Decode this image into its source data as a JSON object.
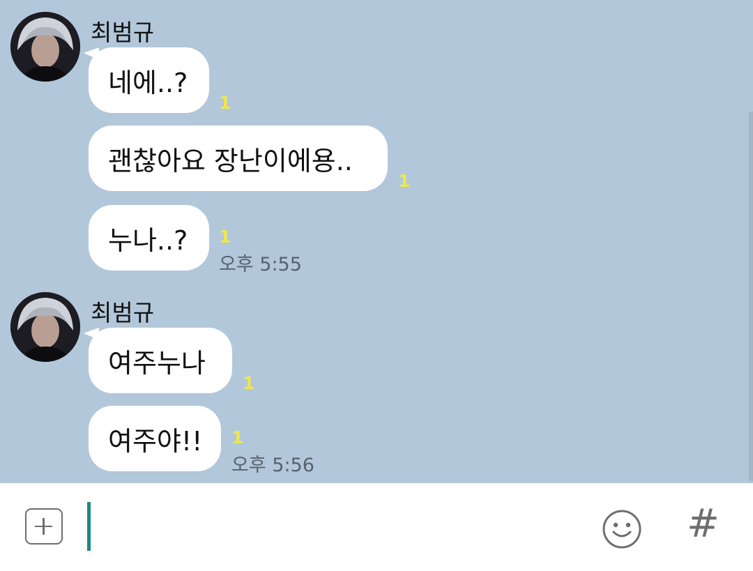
{
  "chat": {
    "groups": [
      {
        "sender": "최범규",
        "messages": [
          {
            "text": "네에..?",
            "unread": "1"
          },
          {
            "text": "괜찮아요 장난이에용..",
            "unread": "1"
          },
          {
            "text": "누나..?",
            "unread": "1",
            "time": "오후 5:55"
          }
        ]
      },
      {
        "sender": "최범규",
        "messages": [
          {
            "text": "여주누나",
            "unread": "1"
          },
          {
            "text": "여주야!!",
            "unread": "1",
            "time": "오후 5:56"
          }
        ]
      }
    ]
  },
  "input_bar": {
    "plus_icon": "plus-square-icon",
    "emoji_icon": "smiley-icon",
    "hash_icon": "hash-icon",
    "hash_label": "#",
    "cursor_color": "#1a8a80"
  },
  "colors": {
    "chat_background": "#b2c7da",
    "bubble": "#ffffff",
    "unread": "#f0e64e"
  }
}
